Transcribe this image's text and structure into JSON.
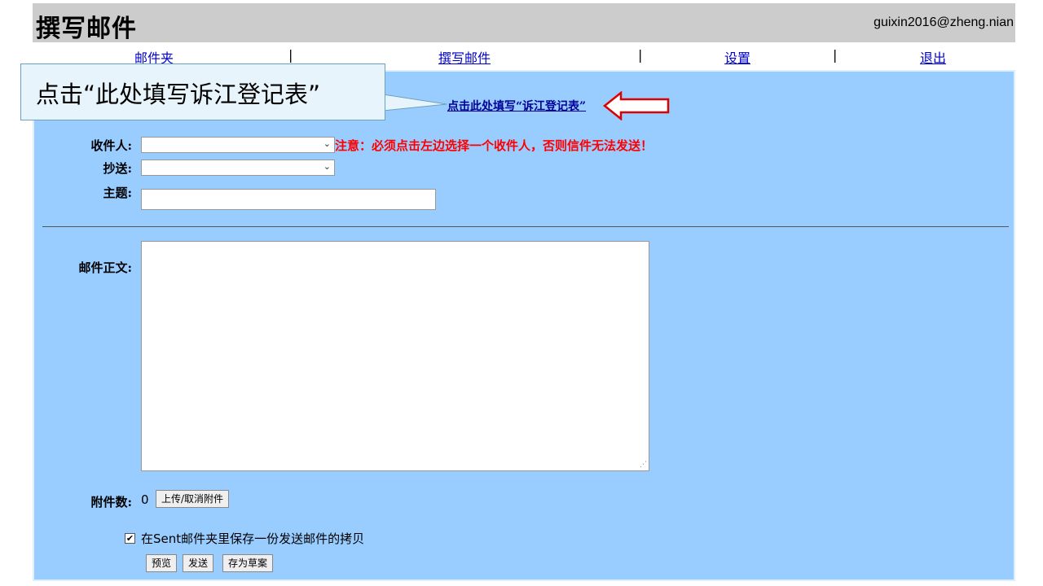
{
  "header": {
    "title": "撰写邮件",
    "user": "guixin2016@zheng.nian"
  },
  "nav": {
    "folders": "邮件夹",
    "compose": "撰写邮件",
    "settings": "设置",
    "logout": "退出",
    "sep": "|"
  },
  "callout": {
    "text": "点击“此处填写诉江登记表”"
  },
  "compose_link": "点击此处填写“诉江登记表”",
  "form": {
    "to_label": "收件人:",
    "cc_label": "抄送:",
    "subject_label": "主题:",
    "warning": "注意：必须点击左边选择一个收件人，否则信件无法发送！",
    "body_label": "邮件正文:",
    "attach_label": "附件数:",
    "attach_count": "0",
    "attach_button": "上传/取消附件",
    "save_copy_label": "在Sent邮件夹里保存一份发送邮件的拷贝",
    "preview_button": "预览",
    "send_button": "发送",
    "draft_button": "存为草案"
  },
  "icons": {
    "dropdown": "chevron-down-icon",
    "check": "checkmark-icon",
    "arrow": "left-arrow-icon"
  },
  "colors": {
    "panel": "#99ccff",
    "header": "#cccccc",
    "warning": "#ff0000",
    "arrow": "#dd0000"
  }
}
